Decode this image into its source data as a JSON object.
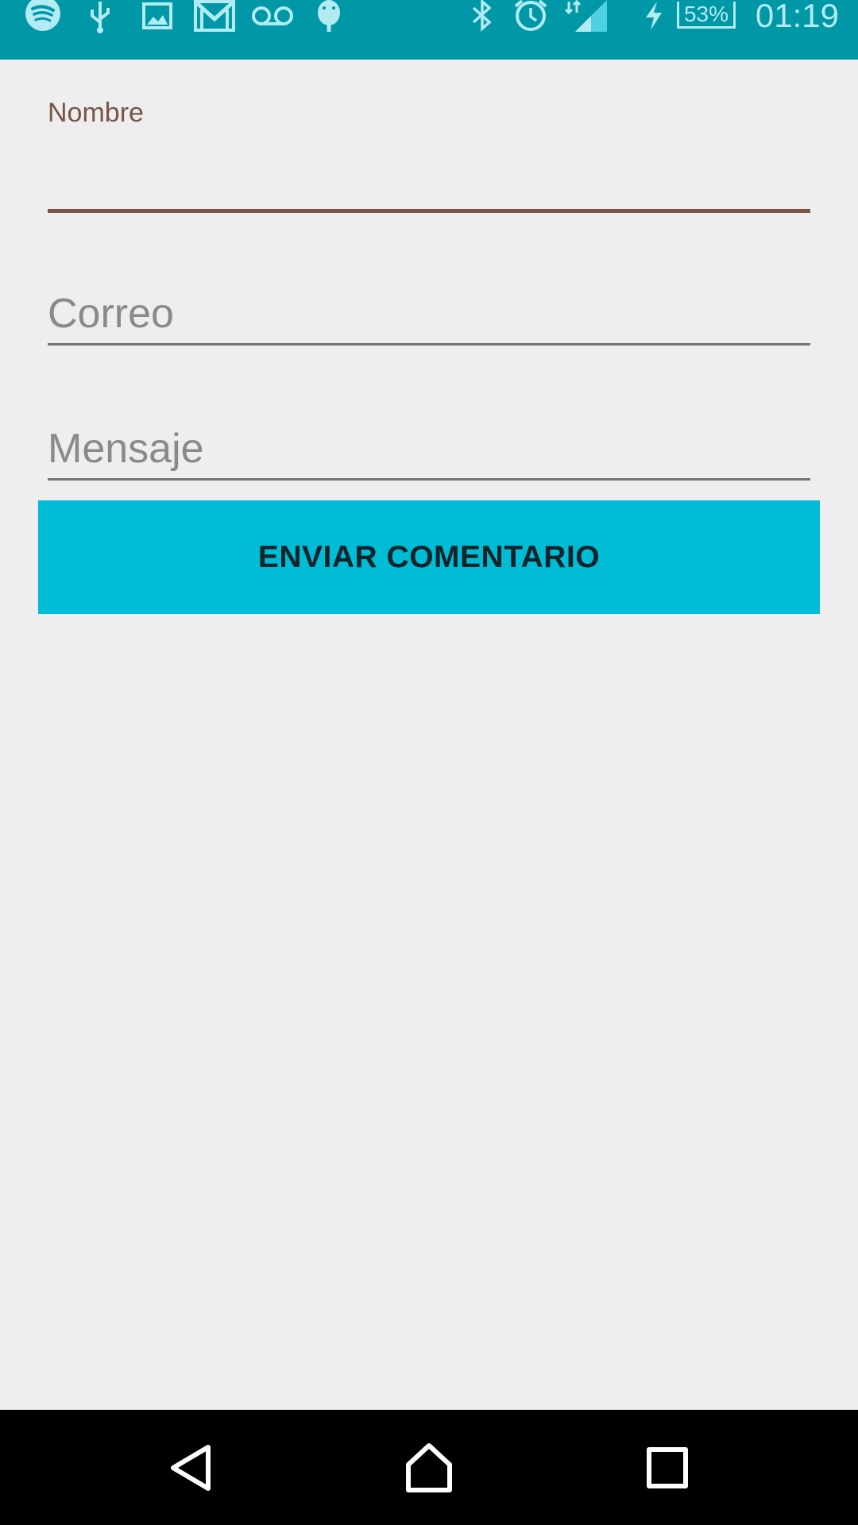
{
  "status_bar": {
    "battery_percent": "53%",
    "clock": "01:19",
    "icons": [
      "spotify-icon",
      "usb-icon",
      "image-icon",
      "gmail-icon",
      "voicemail-icon",
      "android-debug-icon",
      "bluetooth-icon",
      "alarm-icon",
      "signal-icon",
      "charging-icon",
      "battery-icon"
    ]
  },
  "form": {
    "nombre": {
      "label": "Nombre",
      "value": ""
    },
    "correo": {
      "placeholder": "Correo",
      "value": ""
    },
    "mensaje": {
      "placeholder": "Mensaje",
      "value": ""
    },
    "submit_label": "ENVIAR COMENTARIO"
  },
  "colors": {
    "status_bar": "#0097a7",
    "accent": "#00bcd4",
    "focus": "#795548",
    "background": "#eeeeee"
  },
  "nav_bar": {
    "buttons": [
      "back-icon",
      "home-icon",
      "recents-icon"
    ]
  }
}
